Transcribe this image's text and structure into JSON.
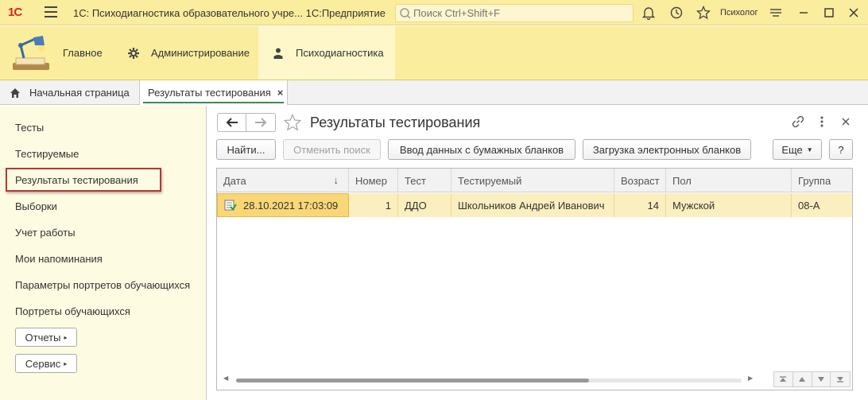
{
  "titlebar": {
    "logo_text": "1С",
    "title": "1С: Психодиагностика образовательного учре...  1С:Предприятие",
    "search_placeholder": "Поиск Ctrl+Shift+F",
    "user": "Психолог",
    "icons": [
      "menu-icon",
      "search-icon",
      "bell-icon",
      "history-icon",
      "star-icon",
      "settings-sliders-icon",
      "minimize-icon",
      "maximize-icon",
      "close-icon"
    ]
  },
  "sections": {
    "items": [
      {
        "label": "Главное",
        "icon": "desk-lamp-icon"
      },
      {
        "label": "Администрирование",
        "icon": "gear-icon"
      },
      {
        "label": "Психодиагностика",
        "icon": "person-icon",
        "active": true
      }
    ]
  },
  "tabs": [
    {
      "label": "Начальная страница",
      "icon": "home-icon"
    },
    {
      "label": "Результаты тестирования",
      "active": true,
      "closable": true,
      "close_glyph": "×"
    }
  ],
  "leftnav": {
    "items": [
      "Тесты",
      "Тестируемые",
      "Результаты тестирования",
      "Выборки",
      "Учет работы",
      "Мои напоминания",
      "Параметры портретов обучающихся",
      "Портреты обучающихся"
    ],
    "selected_index": 2,
    "buttons": [
      {
        "label": "Отчеты",
        "arrow": "▸"
      },
      {
        "label": "Сервис",
        "arrow": "▸"
      }
    ]
  },
  "form": {
    "title": "Результаты тестирования",
    "toolbar": {
      "find": "Найти...",
      "cancel_search": "Отменить поиск",
      "paper_input": "Ввод данных с бумажных бланков",
      "load_electronic": "Загрузка электронных бланков",
      "more": "Еще",
      "help": "?"
    },
    "table": {
      "columns": [
        "Дата",
        "Номер",
        "Тест",
        "Тестируемый",
        "Возраст",
        "Пол",
        "Группа"
      ],
      "sort_arrow": "↓",
      "rows": [
        {
          "date": "28.10.2021 17:03:09",
          "number": "1",
          "test": "ДДО",
          "person": "Школьников Андрей Иванович",
          "age": "14",
          "gender": "Мужской",
          "group": "08-А"
        }
      ]
    }
  },
  "colors": {
    "accent_yellow": "#fbed9e",
    "selection_row": "#fbefbf",
    "highlight_border": "#b03a3a",
    "active_tab_underline": "#3a8c4f"
  }
}
